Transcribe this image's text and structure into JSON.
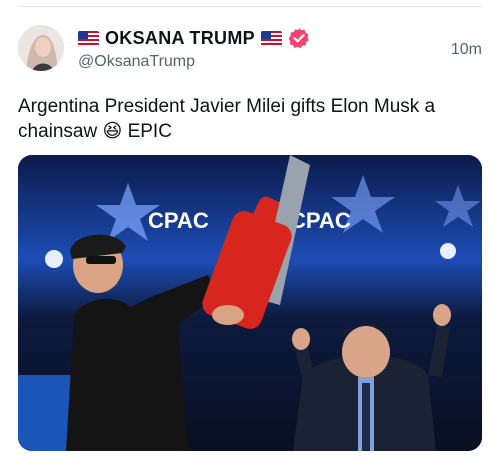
{
  "author": {
    "display_name": "OKSANA TRUMP",
    "handle": "@OksanaTrump",
    "verified": true,
    "flag_icon": "us-flag-icon",
    "verified_color": "#f4436c"
  },
  "tweet": {
    "time": "10m",
    "text": "Argentina President Javier Milei gifts Elon Musk a chainsaw 😆 EPIC"
  },
  "media": {
    "alt": "CPAC stage photo",
    "stage_text": [
      "CPAC",
      "CPAC"
    ]
  },
  "colors": {
    "text_primary": "#0f1419",
    "text_secondary": "#536471",
    "stage_blue": "#1f4fb8",
    "chainsaw_red": "#d7261e"
  }
}
